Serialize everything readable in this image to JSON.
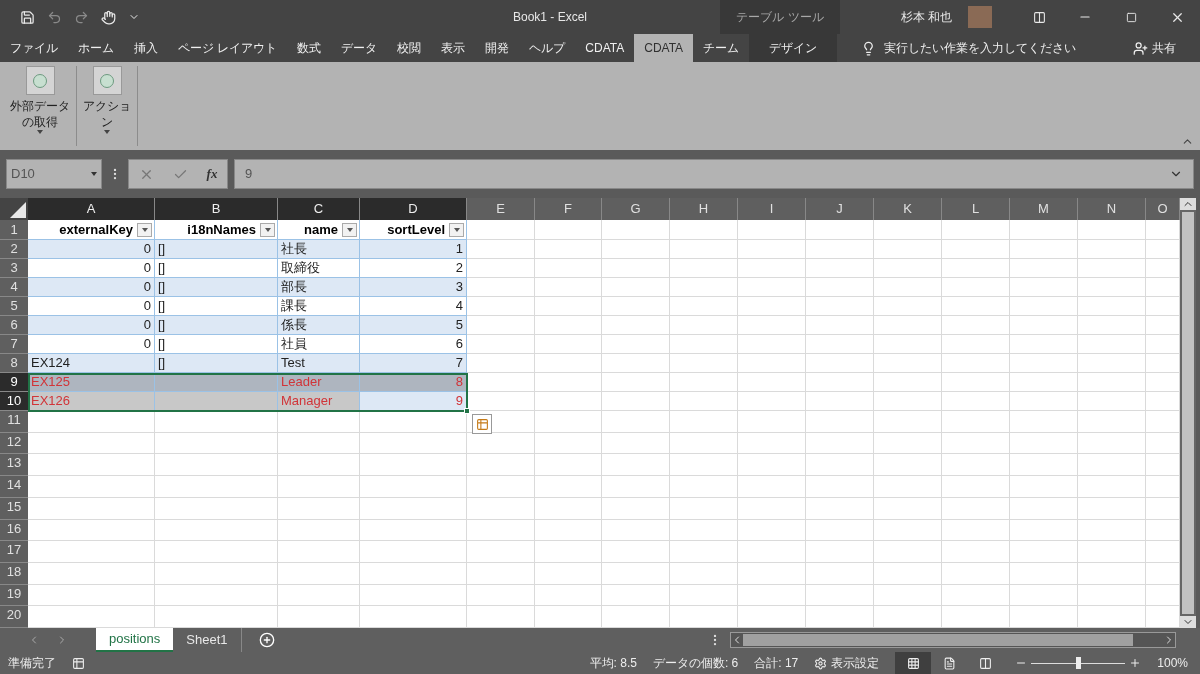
{
  "title_bar": {
    "title": "Book1  -  Excel",
    "context_group": "テーブル ツール",
    "user": "杉本 和也"
  },
  "ribbon_tabs": [
    {
      "label": "ファイル",
      "selected": false,
      "contextual": false
    },
    {
      "label": "ホーム",
      "selected": false,
      "contextual": false
    },
    {
      "label": "挿入",
      "selected": false,
      "contextual": false
    },
    {
      "label": "ページ レイアウト",
      "selected": false,
      "contextual": false
    },
    {
      "label": "数式",
      "selected": false,
      "contextual": false
    },
    {
      "label": "データ",
      "selected": false,
      "contextual": false
    },
    {
      "label": "校閲",
      "selected": false,
      "contextual": false
    },
    {
      "label": "表示",
      "selected": false,
      "contextual": false
    },
    {
      "label": "開発",
      "selected": false,
      "contextual": false
    },
    {
      "label": "ヘルプ",
      "selected": false,
      "contextual": false
    },
    {
      "label": "CDATA",
      "selected": false,
      "contextual": false
    },
    {
      "label": "CDATA",
      "selected": true,
      "contextual": false
    },
    {
      "label": "チーム",
      "selected": false,
      "contextual": false
    },
    {
      "label": "デザイン",
      "selected": false,
      "contextual": true
    }
  ],
  "tell_me": "実行したい作業を入力してください",
  "share": "共有",
  "ribbon_buttons": [
    {
      "label": "外部データの取得"
    },
    {
      "label": "アクション"
    }
  ],
  "formula_bar": {
    "name_box": "D10",
    "function_label": "fx",
    "formula": "9"
  },
  "columns": [
    {
      "letter": "A",
      "selected": true
    },
    {
      "letter": "B",
      "selected": true
    },
    {
      "letter": "C",
      "selected": true
    },
    {
      "letter": "D",
      "selected": true
    },
    {
      "letter": "E",
      "selected": false
    },
    {
      "letter": "F",
      "selected": false
    },
    {
      "letter": "G",
      "selected": false
    },
    {
      "letter": "H",
      "selected": false
    },
    {
      "letter": "I",
      "selected": false
    },
    {
      "letter": "J",
      "selected": false
    },
    {
      "letter": "K",
      "selected": false
    },
    {
      "letter": "L",
      "selected": false
    },
    {
      "letter": "M",
      "selected": false
    },
    {
      "letter": "N",
      "selected": false
    },
    {
      "letter": "O",
      "selected": false
    }
  ],
  "header_row": {
    "number": "1",
    "selected": false,
    "headers": [
      "externalKey",
      "i18nNames",
      "name",
      "sortLevel"
    ]
  },
  "rows": [
    {
      "number": "2",
      "selected": false,
      "cells": [
        {
          "value": "0",
          "numeric": true
        },
        {
          "value": "[]",
          "numeric": false
        },
        {
          "value": "社長",
          "numeric": false
        },
        {
          "value": "1",
          "numeric": true
        }
      ]
    },
    {
      "number": "3",
      "selected": false,
      "cells": [
        {
          "value": "0",
          "numeric": true
        },
        {
          "value": "[]",
          "numeric": false
        },
        {
          "value": "取締役",
          "numeric": false
        },
        {
          "value": "2",
          "numeric": true
        }
      ]
    },
    {
      "number": "4",
      "selected": false,
      "cells": [
        {
          "value": "0",
          "numeric": true
        },
        {
          "value": "[]",
          "numeric": false
        },
        {
          "value": "部長",
          "numeric": false
        },
        {
          "value": "3",
          "numeric": true
        }
      ]
    },
    {
      "number": "5",
      "selected": false,
      "cells": [
        {
          "value": "0",
          "numeric": true
        },
        {
          "value": "[]",
          "numeric": false
        },
        {
          "value": "課長",
          "numeric": false
        },
        {
          "value": "4",
          "numeric": true
        }
      ]
    },
    {
      "number": "6",
      "selected": false,
      "cells": [
        {
          "value": "0",
          "numeric": true
        },
        {
          "value": "[]",
          "numeric": false
        },
        {
          "value": "係長",
          "numeric": false
        },
        {
          "value": "5",
          "numeric": true
        }
      ]
    },
    {
      "number": "7",
      "selected": false,
      "cells": [
        {
          "value": "0",
          "numeric": true
        },
        {
          "value": "[]",
          "numeric": false
        },
        {
          "value": "社員",
          "numeric": false
        },
        {
          "value": "6",
          "numeric": true
        }
      ]
    },
    {
      "number": "8",
      "selected": false,
      "cells": [
        {
          "value": "EX124",
          "numeric": false
        },
        {
          "value": "[]",
          "numeric": false
        },
        {
          "value": "Test",
          "numeric": false
        },
        {
          "value": "7",
          "numeric": true
        }
      ]
    },
    {
      "number": "9",
      "selected": true,
      "color": "#d13438",
      "cells": [
        {
          "value": "EX125",
          "numeric": false
        },
        {},
        {
          "value": "Leader",
          "numeric": false
        },
        {
          "value": "8",
          "numeric": true
        }
      ]
    },
    {
      "number": "10",
      "selected": true,
      "color": "#d13438",
      "cells": [
        {
          "value": "EX126",
          "numeric": false
        },
        {},
        {
          "value": "Manager",
          "numeric": false
        },
        {
          "value": "9",
          "numeric": true,
          "active": true
        }
      ]
    },
    {
      "number": "11",
      "selected": false
    },
    {
      "number": "12",
      "selected": false
    },
    {
      "number": "13",
      "selected": false
    },
    {
      "number": "14",
      "selected": false
    },
    {
      "number": "15",
      "selected": false
    },
    {
      "number": "16",
      "selected": false
    },
    {
      "number": "17",
      "selected": false
    },
    {
      "number": "18",
      "selected": false
    },
    {
      "number": "19",
      "selected": false
    },
    {
      "number": "20",
      "selected": false
    }
  ],
  "sheet_tabs": [
    {
      "label": "positions",
      "selected": true
    },
    {
      "label": "Sheet1",
      "selected": false
    }
  ],
  "status_bar": {
    "ready": "準備完了",
    "stats": [
      "平均: 8.5",
      "データの個数: 6",
      "合計: 17"
    ],
    "display_settings": "表示設定",
    "views": [
      {
        "kind": "normal",
        "selected": true
      },
      {
        "kind": "page-layout",
        "selected": false
      },
      {
        "kind": "page-break",
        "selected": false
      }
    ],
    "zoom": {
      "level": 0.5,
      "reading": "100%"
    }
  }
}
